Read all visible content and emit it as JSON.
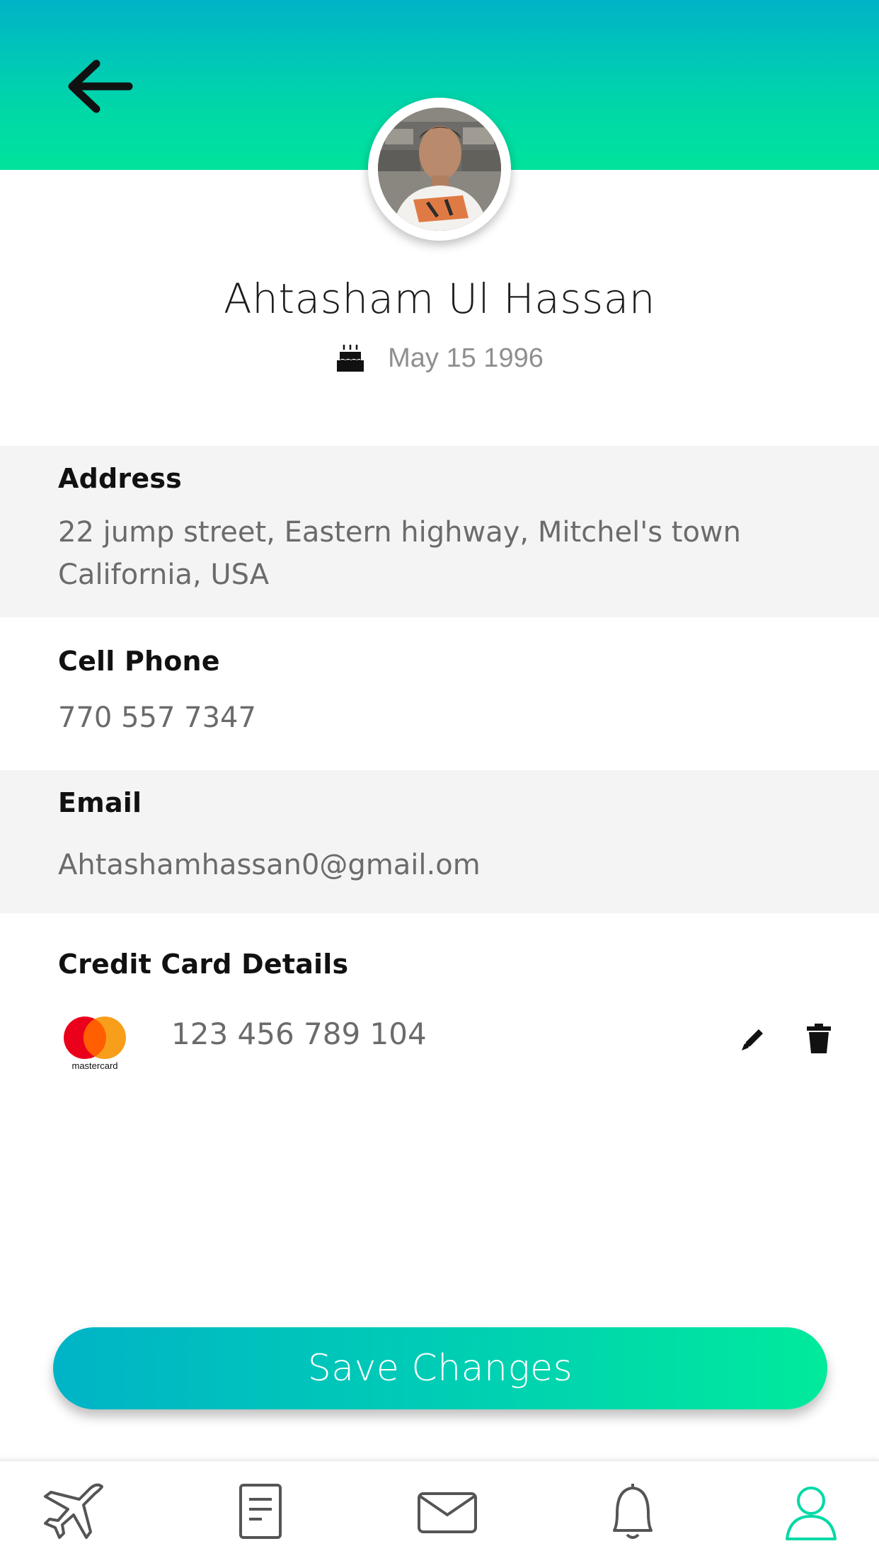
{
  "profile": {
    "name": "Ahtasham Ul Hassan",
    "dob": "May 15 1996"
  },
  "address": {
    "label": "Address",
    "value": "22 jump street, Eastern highway, Mitchel's town California, USA"
  },
  "phone": {
    "label": "Cell Phone",
    "value": "770 557 7347"
  },
  "email": {
    "label": "Email",
    "value": "Ahtashamhassan0@gmail.om"
  },
  "card": {
    "label": "Credit Card Details",
    "brand": "mastercard",
    "number": "123 456 789 104"
  },
  "actions": {
    "save_label": "Save Changes"
  },
  "nav": {
    "items": [
      {
        "icon": "airplane-icon"
      },
      {
        "icon": "document-icon"
      },
      {
        "icon": "mail-icon"
      },
      {
        "icon": "bell-icon"
      },
      {
        "icon": "user-icon",
        "active": true
      }
    ]
  },
  "colors": {
    "accent_start": "#00b4c7",
    "accent_end": "#00ea9c",
    "nav_active": "#00d9a6",
    "nav_inactive": "#555555"
  }
}
